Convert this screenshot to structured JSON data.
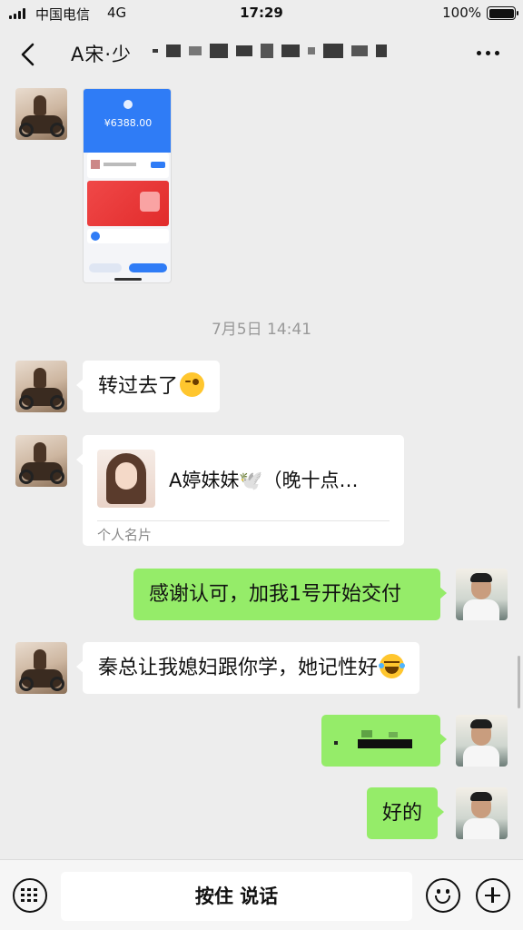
{
  "status_bar": {
    "carrier": "中国电信",
    "network": "4G",
    "time": "17:29",
    "battery": "100%"
  },
  "header": {
    "title": "A宋·少"
  },
  "messages": {
    "screenshot": {
      "amount": "¥6388.00"
    },
    "timestamp": "7月5日 14:41",
    "transferred": "转过去了",
    "card": {
      "name": "A婷妹妹🕊️（晚十点…",
      "label": "个人名片"
    },
    "thanks": "感谢认可，加我1号开始交付",
    "qin": "秦总让我媳妇跟你学，她记性好",
    "ok": "好的"
  },
  "input_bar": {
    "hold_to_talk": "按住 说话"
  },
  "icons": {
    "back": "chevron-left-icon",
    "more": "more-dots-icon",
    "keyboard": "keyboard-icon",
    "emoji": "smiley-icon",
    "plus": "plus-icon"
  },
  "colors": {
    "background": "#ededed",
    "outgoing_bubble": "#95ec69",
    "incoming_bubble": "#ffffff",
    "timestamp": "#999999"
  }
}
